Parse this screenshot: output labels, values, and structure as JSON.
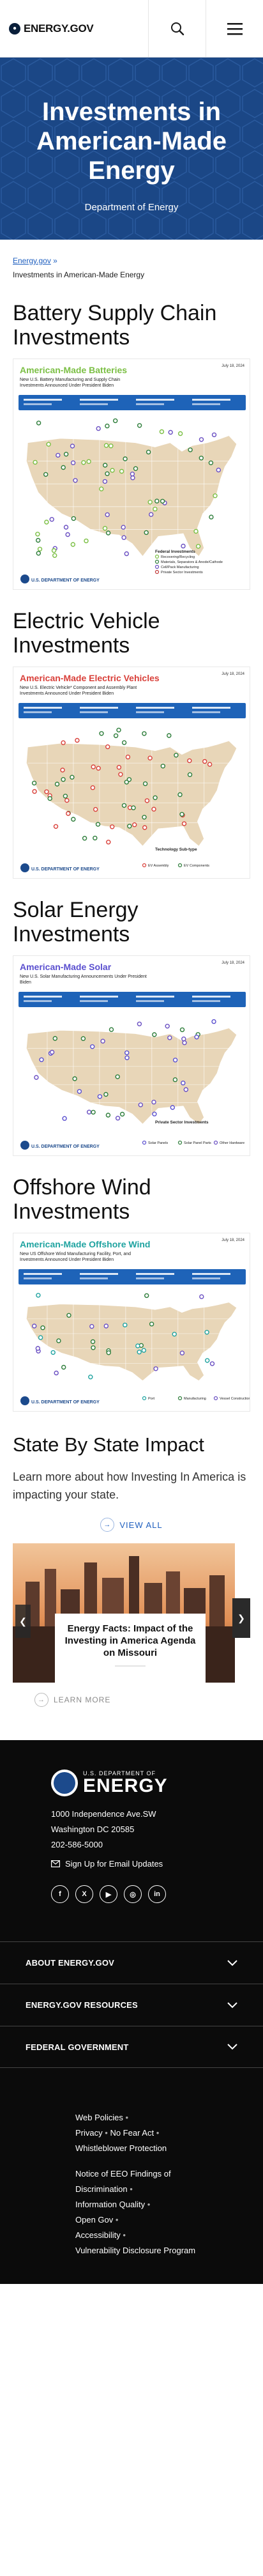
{
  "header": {
    "logo_text": "ENERGY.GOV",
    "search_icon": "search-icon",
    "menu_icon": "hamburger-menu-icon"
  },
  "hero": {
    "title": "Investments in American-Made Energy",
    "subtitle": "Department of Energy"
  },
  "breadcrumb": {
    "home": "Energy.gov",
    "separator": "»",
    "current": "Investments in American-Made Energy"
  },
  "sections": [
    {
      "title": "Battery Supply Chain Investments",
      "map": {
        "heading": "American-Made Batteries",
        "subheading": "New U.S. Battery Manufacturing and Supply Chain Investments Announced Under President Biden",
        "date": "July 18, 2024",
        "legend_title": "Federal Investments",
        "legend": [
          "Recovering/Recycling",
          "Materials, Separators & Anode/Cathode",
          "Cell/Pack Manufacturing",
          "Private Sector Investments"
        ],
        "footer_org": "U.S. DEPARTMENT OF ENERGY",
        "accent": "#7bbf44"
      }
    },
    {
      "title": "Electric Vehicle Investments",
      "map": {
        "heading": "American-Made Electric Vehicles",
        "subheading": "New U.S. Electric Vehicle* Component and Assembly Plant Investments Announced Under President Biden",
        "date": "July 18, 2024",
        "legend_title": "Technology Sub-type",
        "legend": [
          "EV Assembly",
          "EV Components"
        ],
        "footer_org": "U.S. DEPARTMENT OF ENERGY",
        "accent": "#d9403a"
      }
    },
    {
      "title": "Solar Energy Investments",
      "map": {
        "heading": "American-Made Solar",
        "subheading": "New U.S. Solar Manufacturing Announcements Under President Biden",
        "date": "July 18, 2024",
        "legend_title": "Private Sector Investments",
        "legend": [
          "Solar Panels",
          "Solar Panel Parts",
          "Other Hardware"
        ],
        "footer_org": "U.S. DEPARTMENT OF ENERGY",
        "accent": "#5a4fcf"
      }
    },
    {
      "title": "Offshore Wind Investments",
      "map": {
        "heading": "American-Made Offshore Wind",
        "subheading": "New US Offshore Wind Manufacturing Facility, Port, and Investments Announced Under President Biden",
        "date": "July 18, 2024",
        "legend": [
          "Port",
          "Manufacturing",
          "Vessel Construction"
        ],
        "footer_org": "U.S. DEPARTMENT OF ENERGY",
        "accent": "#1fa3a0"
      }
    }
  ],
  "state_by_state": {
    "title": "State By State Impact",
    "text": "Learn more about how Investing In America is impacting your state.",
    "view_all": "VIEW ALL",
    "slide_title": "Energy Facts: Impact of the Investing in America Agenda on Missouri",
    "learn_more": "LEARN MORE"
  },
  "footer": {
    "brand_small": "U.S. DEPARTMENT OF",
    "brand_large": "ENERGY",
    "address_line1": "1000 Independence Ave.SW",
    "address_line2": "Washington DC 20585",
    "phone": "202-586-5000",
    "signup": "Sign Up for Email Updates",
    "social": [
      "f",
      "X",
      "▶",
      "◎",
      "in"
    ],
    "accordions": [
      "ABOUT ENERGY.GOV",
      "ENERGY.GOV RESOURCES",
      "FEDERAL GOVERNMENT"
    ],
    "links": {
      "web_policies": "Web Policies",
      "privacy": "Privacy",
      "no_fear": "No Fear Act",
      "whistleblower": "Whistleblower Protection",
      "eeo": "Notice of EEO Findings of Discrimination",
      "info_quality": "Information Quality",
      "open_gov": "Open Gov",
      "accessibility": "Accessibility",
      "vdp": "Vulnerability Disclosure Program",
      "sep_dot": "•"
    }
  }
}
